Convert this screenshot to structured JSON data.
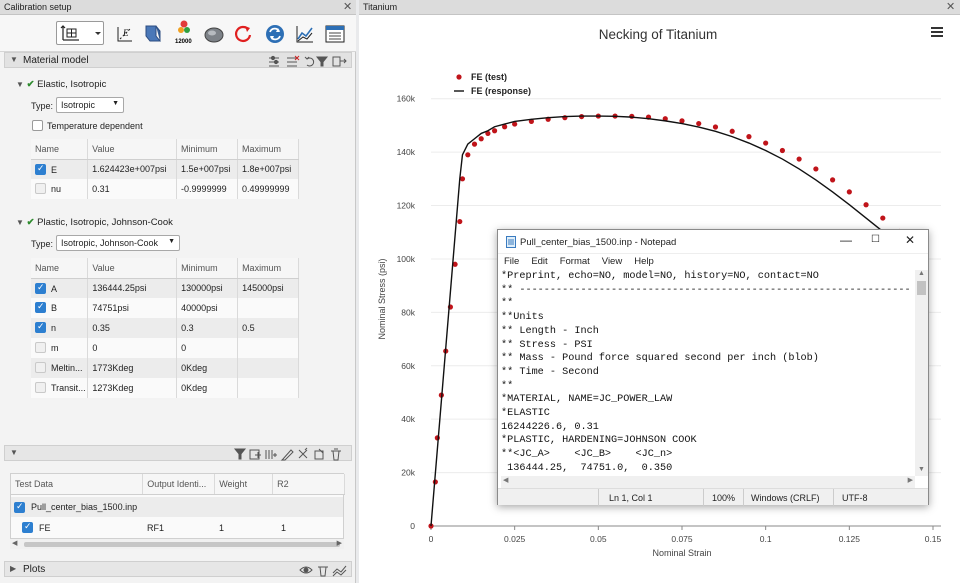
{
  "left_panel": {
    "tab_title": "Calibration setup",
    "material_model": {
      "header": "Material model",
      "elastic": {
        "title": "Elastic, Isotropic",
        "type_label": "Type:",
        "type_value": "Isotropic",
        "temp_dependent_label": "Temperature dependent",
        "columns": [
          "Name",
          "Value",
          "Minimum",
          "Maximum"
        ],
        "rows": [
          {
            "name": "E",
            "value": "1.624423e+007psi",
            "min": "1.5e+007psi",
            "max": "1.8e+007psi",
            "checked": true
          },
          {
            "name": "nu",
            "value": "0.31",
            "min": "-0.9999999",
            "max": "0.49999999",
            "checked": false
          }
        ]
      },
      "plastic": {
        "title": "Plastic, Isotropic, Johnson-Cook",
        "type_label": "Type:",
        "type_value": "Isotropic, Johnson-Cook",
        "columns": [
          "Name",
          "Value",
          "Minimum",
          "Maximum"
        ],
        "rows": [
          {
            "name": "A",
            "value": "136444.25psi",
            "min": "130000psi",
            "max": "145000psi",
            "checked": true
          },
          {
            "name": "B",
            "value": "74751psi",
            "min": "40000psi",
            "max": "",
            "checked": true
          },
          {
            "name": "n",
            "value": "0.35",
            "min": "0.3",
            "max": "0.5",
            "checked": true
          },
          {
            "name": "m",
            "value": "0",
            "min": "0",
            "max": "",
            "checked": false
          },
          {
            "name": "Meltin...",
            "value": "1773Kdeg",
            "min": "0Kdeg",
            "max": "",
            "checked": false
          },
          {
            "name": "Transit...",
            "value": "1273Kdeg",
            "min": "0Kdeg",
            "max": "",
            "checked": false
          }
        ]
      }
    },
    "test_data": {
      "columns": [
        "Test Data",
        "Output Identi...",
        "Weight",
        "R2"
      ],
      "file": "Pull_center_bias_1500.inp",
      "row": {
        "name": "FE",
        "output": "RF1",
        "weight": "1",
        "r2": "1"
      }
    },
    "plots_label": "Plots"
  },
  "right_panel": {
    "tab_title": "Titanium",
    "chart_data": {
      "type": "line",
      "title": "Necking of Titanium",
      "xlabel": "Nominal Strain",
      "ylabel": "Nominal Stress (psi)",
      "xlim": [
        0,
        0.15
      ],
      "ylim": [
        0,
        170000
      ],
      "x_ticks": [
        "0",
        "0.025",
        "0.05",
        "0.075",
        "0.1",
        "0.125",
        "0.15"
      ],
      "y_ticks": [
        "0",
        "20k",
        "40k",
        "60k",
        "80k",
        "100k",
        "120k",
        "140k",
        "160k"
      ],
      "legend_position": "top-left",
      "series": [
        {
          "name": "FE (test)",
          "style": "markers",
          "color": "#c0141a",
          "x": [
            0,
            0.0013,
            0.0019,
            0.0031,
            0.0044,
            0.0058,
            0.0072,
            0.0086,
            0.0094,
            0.011,
            0.013,
            0.015,
            0.017,
            0.019,
            0.022,
            0.025,
            0.03,
            0.035,
            0.04,
            0.045,
            0.05,
            0.055,
            0.06,
            0.065,
            0.07,
            0.075,
            0.08,
            0.085,
            0.09,
            0.095,
            0.1,
            0.105,
            0.11,
            0.115,
            0.12,
            0.125,
            0.13,
            0.135,
            0.14,
            0.145,
            0.15
          ],
          "y": [
            0,
            16500,
            33000,
            49000,
            65500,
            82000,
            98000,
            114000,
            130000,
            139000,
            143000,
            145000,
            147000,
            148000,
            149500,
            150500,
            151500,
            152300,
            152900,
            153300,
            153500,
            153500,
            153400,
            153100,
            152500,
            151700,
            150700,
            149400,
            147800,
            145800,
            143400,
            140600,
            137400,
            133700,
            129600,
            125100,
            120300,
            115300,
            110300
          ]
        },
        {
          "name": "FE (response)",
          "style": "line",
          "color": "#111111",
          "x": [
            0,
            0.0086,
            0.0094,
            0.011,
            0.013,
            0.015,
            0.017,
            0.019,
            0.022,
            0.025,
            0.03,
            0.035,
            0.04,
            0.045,
            0.05,
            0.055,
            0.06,
            0.065,
            0.07,
            0.075,
            0.08,
            0.085,
            0.09,
            0.095,
            0.1,
            0.105,
            0.11,
            0.115,
            0.12,
            0.125,
            0.13,
            0.135,
            0.14,
            0.145,
            0.15
          ],
          "y": [
            0,
            130000,
            139000,
            143000,
            145000,
            147000,
            148000,
            149500,
            150500,
            151500,
            152300,
            152900,
            153300,
            153500,
            153500,
            153400,
            153100,
            152500,
            151700,
            150700,
            149400,
            147800,
            145800,
            143400,
            140600,
            137400,
            133700,
            129600,
            125100,
            120300,
            115300,
            110300,
            109000,
            109000
          ]
        }
      ]
    }
  },
  "notepad": {
    "title": "Pull_center_bias_1500.inp - Notepad",
    "menu": [
      "File",
      "Edit",
      "Format",
      "View",
      "Help"
    ],
    "lines": [
      "*Preprint, echo=NO, model=NO, history=NO, contact=NO",
      "** ----------------------------------------------------------------",
      "**",
      "**Units",
      "** Length - Inch",
      "** Stress - PSI",
      "** Mass - Pound force squared second per inch (blob)",
      "** Time - Second",
      "**",
      "*MATERIAL, NAME=JC_POWER_LAW",
      "*ELASTIC",
      "16244226.6, 0.31",
      "*PLASTIC, HARDENING=JOHNSON COOK",
      "**<JC_A>    <JC_B>    <JC_n>",
      " 136444.25,  74751.0,  0.350"
    ],
    "status": {
      "position": "Ln 1, Col 1",
      "zoom": "100%",
      "eol": "Windows (CRLF)",
      "encoding": "UTF-8"
    }
  }
}
